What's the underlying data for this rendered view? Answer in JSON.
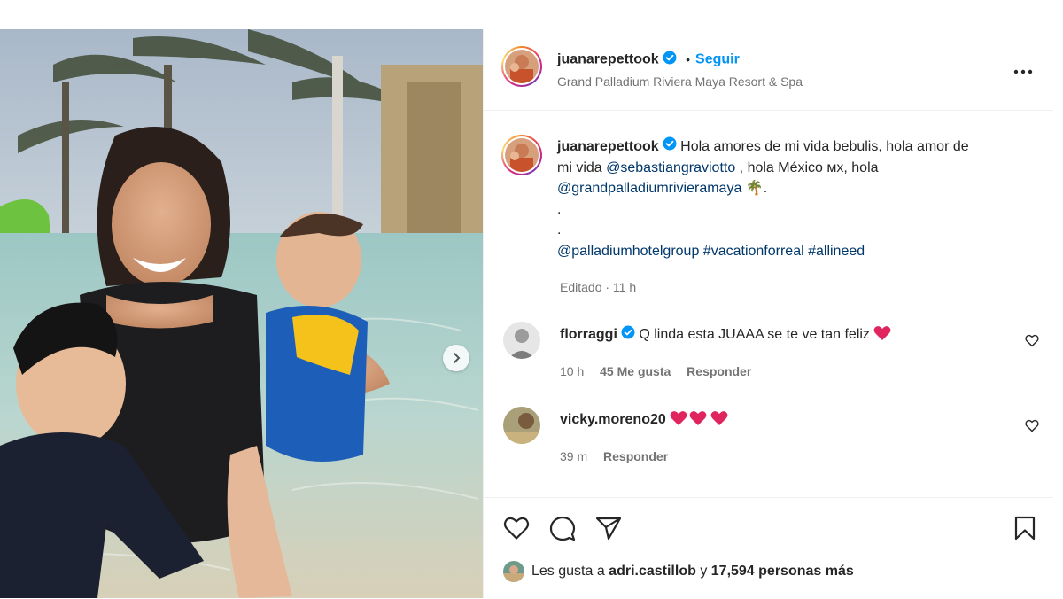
{
  "post": {
    "username": "juanarepettook",
    "separator": "•",
    "follow_label": "Seguir",
    "location": "Grand Palladium Riviera Maya Resort & Spa",
    "caption": {
      "line1_text": "Hola amores de mi vida bebulis, hola amor de",
      "line2_prefix": "mi vida ",
      "mention1": "@sebastiangraviotto",
      "line2_suffix": " , hola México ᴍx, hola",
      "mention2": "@grandpalladiumrivieramaya",
      "line3_suffix": " 🌴.",
      "dot1": ".",
      "dot2": ".",
      "tag_mention": "@palladiumhotelgroup",
      "hashtag1": "#vacationforreal",
      "hashtag2": "#allineed"
    },
    "edited_label": "Editado · 11 h"
  },
  "comments": [
    {
      "username": "florraggi",
      "verified": true,
      "text": "Q linda esta JUAAA se te ve tan feliz",
      "hearts": 1,
      "time": "10 h",
      "likes": "45 Me gusta",
      "reply_label": "Responder"
    },
    {
      "username": "vicky.moreno20",
      "verified": false,
      "text": "",
      "hearts": 3,
      "time": "39 m",
      "reply_label": "Responder"
    }
  ],
  "likes_line": {
    "prefix": "Les gusta a ",
    "user": "adri.castillob",
    "middle": " y ",
    "count": "17,594 personas más"
  },
  "icons": {
    "verified": "verified-badge-icon",
    "more": "more-options-icon",
    "next": "chevron-right-icon",
    "like": "heart-icon",
    "comment": "comment-bubble-icon",
    "share": "paper-plane-icon",
    "save": "bookmark-icon"
  },
  "colors": {
    "accent": "#0095f6",
    "mention": "#00376b",
    "heart_emoji": "#e0245e",
    "secondary_text": "#737373"
  }
}
